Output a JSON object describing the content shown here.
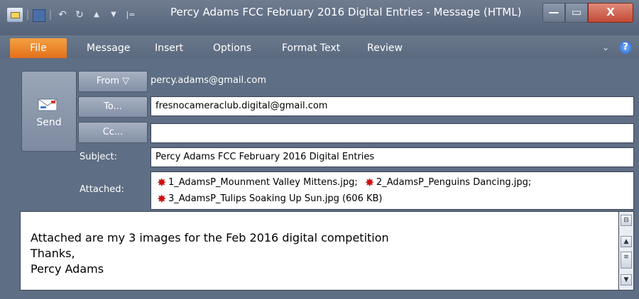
{
  "window": {
    "title": "Percy Adams FCC February 2016 Digital Entries  -  Message (HTML)",
    "qat_undo": "↶",
    "qat_redo": "↻",
    "qat_up": "▲",
    "qat_down": "▼",
    "qat_customize": "|=",
    "minimize": "—",
    "maximize": "▭",
    "close": "X"
  },
  "ribbon": {
    "tabs": [
      "File",
      "Message",
      "Insert",
      "Options",
      "Format Text",
      "Review"
    ],
    "collapse": "⌄",
    "help": "?"
  },
  "header": {
    "send_label": "Send",
    "from_button": "From ▽",
    "from_value": "percy.adams@gmail.com",
    "to_button": "To...",
    "to_value": "fresnocameraclub.digital@gmail.com",
    "cc_button": "Cc...",
    "cc_value": "",
    "subject_label": "Subject:",
    "subject_value": "Percy Adams FCC February 2016 Digital Entries",
    "attached_label": "Attached:",
    "attachments": [
      "1_AdamsP_Mounment Valley Mittens.jpg;",
      "2_AdamsP_Penguins Dancing.jpg;",
      "3_AdamsP_Tulips Soaking Up Sun.jpg (606 KB)"
    ]
  },
  "body": {
    "text": "Attached are my 3 images for the Feb 2016 digital competition\nThanks,\nPercy Adams"
  },
  "colors": {
    "file_tab": "#e2701b",
    "chrome": "#5e6e84",
    "attachment_icon": "#d10f0f"
  }
}
